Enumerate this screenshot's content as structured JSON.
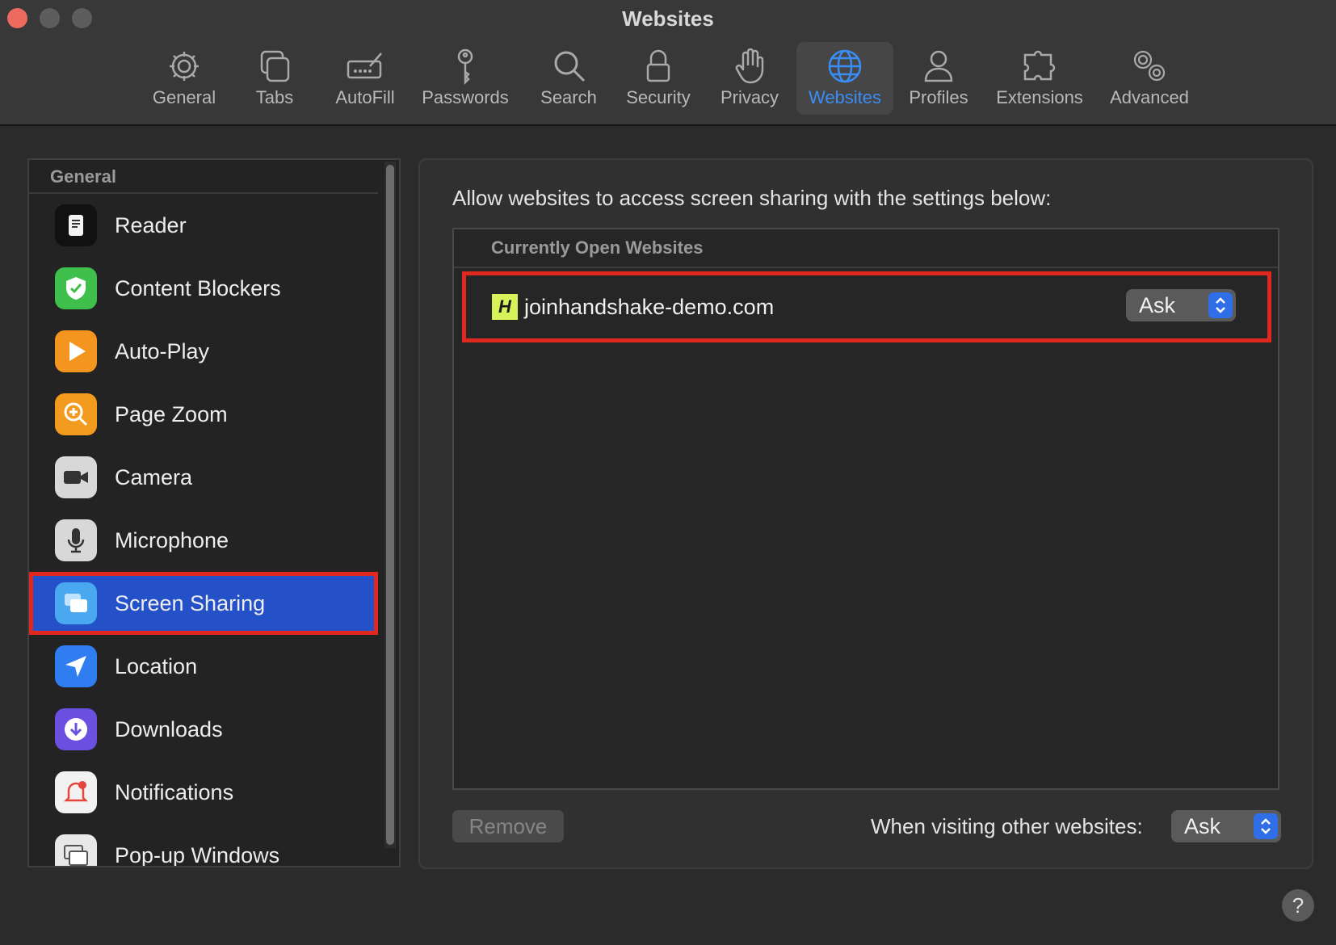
{
  "window": {
    "title": "Websites"
  },
  "toolbar": {
    "items": [
      {
        "label": "General",
        "icon": "gear-icon"
      },
      {
        "label": "Tabs",
        "icon": "tabs-icon"
      },
      {
        "label": "AutoFill",
        "icon": "autofill-icon"
      },
      {
        "label": "Passwords",
        "icon": "key-icon"
      },
      {
        "label": "Search",
        "icon": "magnifier-icon"
      },
      {
        "label": "Security",
        "icon": "lock-icon"
      },
      {
        "label": "Privacy",
        "icon": "hand-icon"
      },
      {
        "label": "Websites",
        "icon": "globe-icon",
        "active": true
      },
      {
        "label": "Profiles",
        "icon": "person-icon"
      },
      {
        "label": "Extensions",
        "icon": "puzzle-icon"
      },
      {
        "label": "Advanced",
        "icon": "gears-icon"
      }
    ],
    "active_color": "#3a8df5"
  },
  "sidebar": {
    "header": "General",
    "items": [
      {
        "label": "Reader",
        "icon": "reader-icon"
      },
      {
        "label": "Content Blockers",
        "icon": "shield-check-icon"
      },
      {
        "label": "Auto-Play",
        "icon": "play-icon"
      },
      {
        "label": "Page Zoom",
        "icon": "zoom-icon"
      },
      {
        "label": "Camera",
        "icon": "camera-icon"
      },
      {
        "label": "Microphone",
        "icon": "microphone-icon"
      },
      {
        "label": "Screen Sharing",
        "icon": "screen-sharing-icon",
        "selected": true
      },
      {
        "label": "Location",
        "icon": "location-arrow-icon"
      },
      {
        "label": "Downloads",
        "icon": "download-icon"
      },
      {
        "label": "Notifications",
        "icon": "bell-icon"
      },
      {
        "label": "Pop-up Windows",
        "icon": "popup-windows-icon"
      }
    ],
    "selected_color": "#2450c8"
  },
  "main": {
    "description": "Allow websites to access screen sharing with the settings below:",
    "table_header": "Currently Open Websites",
    "sites": [
      {
        "favicon_letter": "H",
        "domain": "joinhandshake-demo.com",
        "setting": "Ask"
      }
    ],
    "remove_label": "Remove",
    "other_websites_label": "When visiting other websites:",
    "other_websites_value": "Ask",
    "help_label": "?"
  },
  "highlight_color": "#e0281f"
}
